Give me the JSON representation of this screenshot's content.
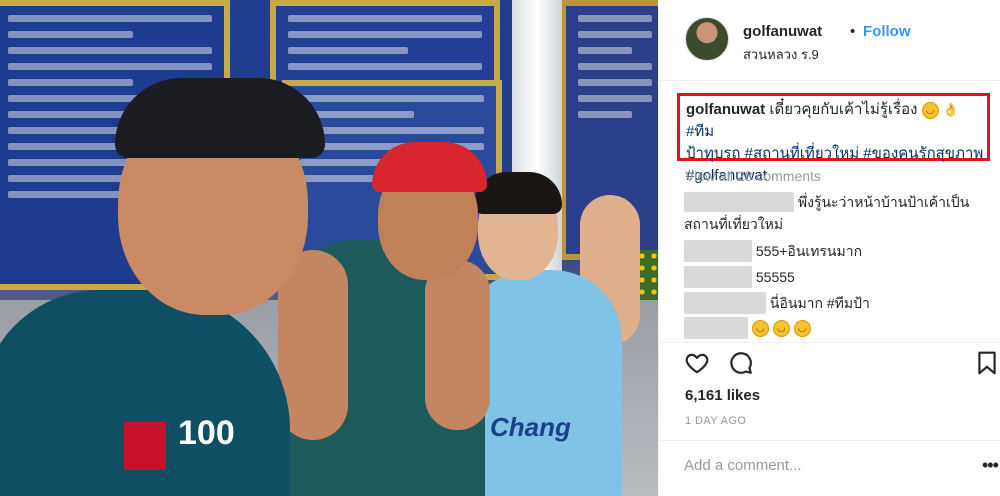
{
  "post": {
    "username": "golfanuwat",
    "dot": "•",
    "follow_label": "Follow",
    "location": "สวนหลวง ร.9",
    "caption": {
      "author": "golfanuwat",
      "text": " เดี๋ยวคุยกับเค้าไม่รู้เรื่อง",
      "tags_line1": "#ทีม",
      "tags_line2": "ป้าทุบรถ #สถานที่เที่ยวใหม่ #ของคนรักสุขภาพ",
      "tags_line3": "#golfanuwat"
    },
    "view_all": "View all 28 comments",
    "comments": [
      {
        "text_line1": "พึ่งรู้นะว่าหน้าบ้านป้าเค้าเป็น",
        "text_line2": "สถานที่เที่ยวใหม่"
      },
      {
        "text": "555+อินเทรนมาก"
      },
      {
        "text": "55555"
      },
      {
        "text": "นี่อินมาก #ทีมป้า"
      }
    ],
    "likes": "6,161 likes",
    "time_ago": "1 DAY AGO",
    "add_comment_placeholder": "Add a comment...",
    "more_label": "•••"
  },
  "photo": {
    "jersey_number": "100",
    "shirt_brand": "Chang"
  },
  "colors": {
    "link_blue": "#3897f0",
    "highlight_red": "#e0141e",
    "muted_gray": "#999999"
  }
}
